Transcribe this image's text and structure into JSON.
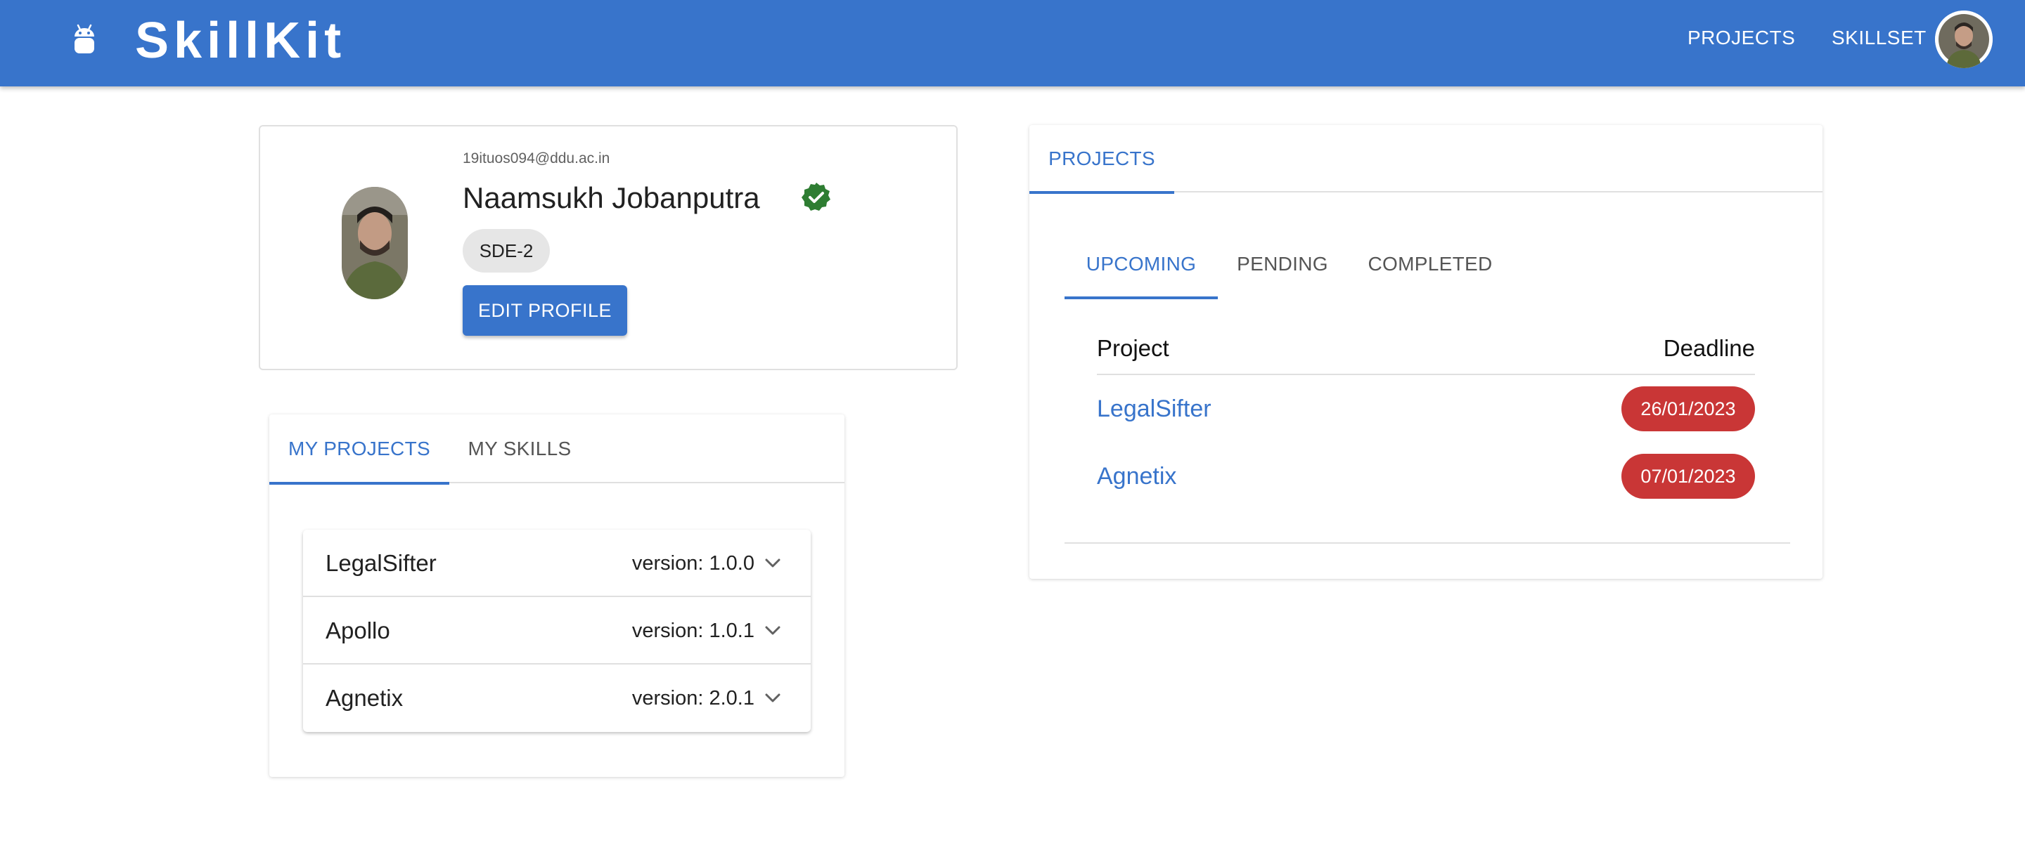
{
  "app": {
    "title": "SkillKit",
    "brand_icon": "android-icon",
    "nav": {
      "projects_label": "PROJECTS",
      "skillset_label": "SKILLSET"
    }
  },
  "colors": {
    "primary": "#3874cb",
    "verified": "#2e7d32",
    "deadline_badge": "#c93636",
    "chip": "#e6e6e6"
  },
  "profile": {
    "email": "19ituos094@ddu.ac.in",
    "name": "Naamsukh Jobanputra",
    "verified_icon": "verified-badge-icon",
    "role": "SDE-2",
    "edit_label": "EDIT PROFILE"
  },
  "my_section": {
    "tabs": [
      {
        "label": "MY PROJECTS",
        "active": true
      },
      {
        "label": "MY SKILLS",
        "active": false
      }
    ],
    "projects": [
      {
        "name": "LegalSifter",
        "version": "version: 1.0.0"
      },
      {
        "name": "Apollo",
        "version": "version: 1.0.1"
      },
      {
        "name": "Agnetix",
        "version": "version: 2.0.1"
      }
    ]
  },
  "projects_panel": {
    "tab_label": "PROJECTS",
    "subtabs": [
      {
        "label": "UPCOMING",
        "active": true
      },
      {
        "label": "PENDING",
        "active": false
      },
      {
        "label": "COMPLETED",
        "active": false
      }
    ],
    "columns": [
      "Project",
      "Deadline"
    ],
    "rows": [
      {
        "project": "LegalSifter",
        "deadline": "26/01/2023"
      },
      {
        "project": "Agnetix",
        "deadline": "07/01/2023"
      }
    ]
  }
}
